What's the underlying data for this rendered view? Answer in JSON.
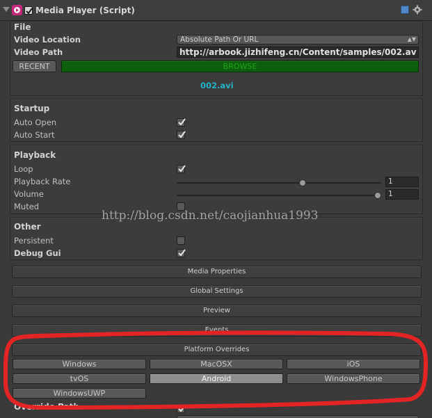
{
  "component": {
    "title": "Media Player (Script)",
    "enabled": true,
    "icon": "media-player-script-icon"
  },
  "file": {
    "title": "File",
    "video_location_label": "Video Location",
    "video_location_value": "Absolute Path Or URL",
    "video_path_label": "Video Path",
    "video_path_value": "http://arbook.jizhifeng.cn/Content/samples/002.av",
    "recent_label": "RECENT",
    "browse_label": "BROWSE",
    "filename": "002.avi",
    "browse_color": "#0d5e0d",
    "filename_color": "#22b3c8"
  },
  "startup": {
    "title": "Startup",
    "auto_open_label": "Auto Open",
    "auto_open": true,
    "auto_start_label": "Auto Start",
    "auto_start": true
  },
  "playback": {
    "title": "Playback",
    "loop_label": "Loop",
    "loop": true,
    "rate_label": "Playback Rate",
    "rate_value": "1",
    "rate_fraction": 0.62,
    "volume_label": "Volume",
    "volume_value": "1",
    "volume_fraction": 1.0,
    "muted_label": "Muted",
    "muted": false
  },
  "other": {
    "title": "Other",
    "persistent_label": "Persistent",
    "persistent": false,
    "debug_gui_label": "Debug Gui",
    "debug_gui": true
  },
  "foldouts": {
    "media_properties": "Media Properties",
    "global_settings": "Global Settings",
    "preview": "Preview",
    "events": "Events",
    "platform_overrides": "Platform Overrides"
  },
  "platforms": {
    "windows": "Windows",
    "macosx": "MacOSX",
    "ios": "iOS",
    "tvos": "tvOS",
    "android": "Android",
    "windowsphone": "WindowsPhone",
    "windowsuwp": "WindowsUWP",
    "selected": "Android"
  },
  "partial_below": {
    "override_path_label": "Override Path"
  },
  "watermark": "http://blog.csdn.net/caojianhua1993",
  "annotation_color": "#e32424"
}
